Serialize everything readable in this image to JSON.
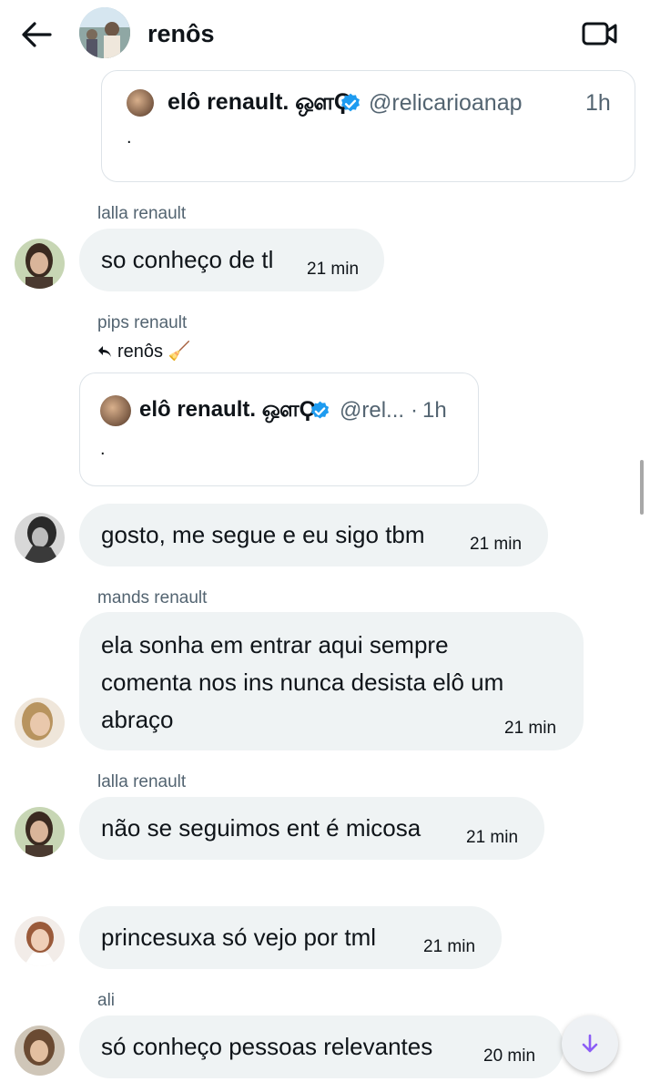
{
  "header": {
    "back_icon": "arrow-left-icon",
    "title": "renôs",
    "video_icon": "video-camera-icon"
  },
  "top_quote": {
    "name": "elô renault. ஔϘ",
    "handle": "@relicarioanap",
    "time": "1h",
    "body": "."
  },
  "messages": [
    {
      "sender": "lalla renault",
      "text": "so conheço de tl",
      "time": "21 min"
    },
    {
      "sender": "pips renault",
      "reply_to": "renôs 🧹",
      "quote": {
        "name": "elô renault. ஔϘ",
        "handle": "@rel...",
        "separator": "·",
        "time": "1h",
        "body": "."
      },
      "text": "gosto, me segue e eu sigo tbm",
      "time": "21 min"
    },
    {
      "sender": "mands renault",
      "lines": [
        "ela sonha em entrar aqui sempre",
        "comenta nos ins nunca desista elô um",
        "abraço"
      ],
      "time": "21 min"
    },
    {
      "sender": "lalla renault",
      "text": "não se seguimos ent é micosa",
      "time": "21 min"
    },
    {
      "sender": "",
      "text": "princesuxa só vejo por tml",
      "time": "21 min"
    },
    {
      "sender": "ali",
      "text": "só conheço pessoas relevantes",
      "time": "20 min"
    }
  ],
  "scroll_down_icon": "arrow-down-icon",
  "colors": {
    "bubble": "#eff3f4",
    "verified": "#1d9bf0",
    "muted": "#536471",
    "accent": "#8b5cf6"
  }
}
